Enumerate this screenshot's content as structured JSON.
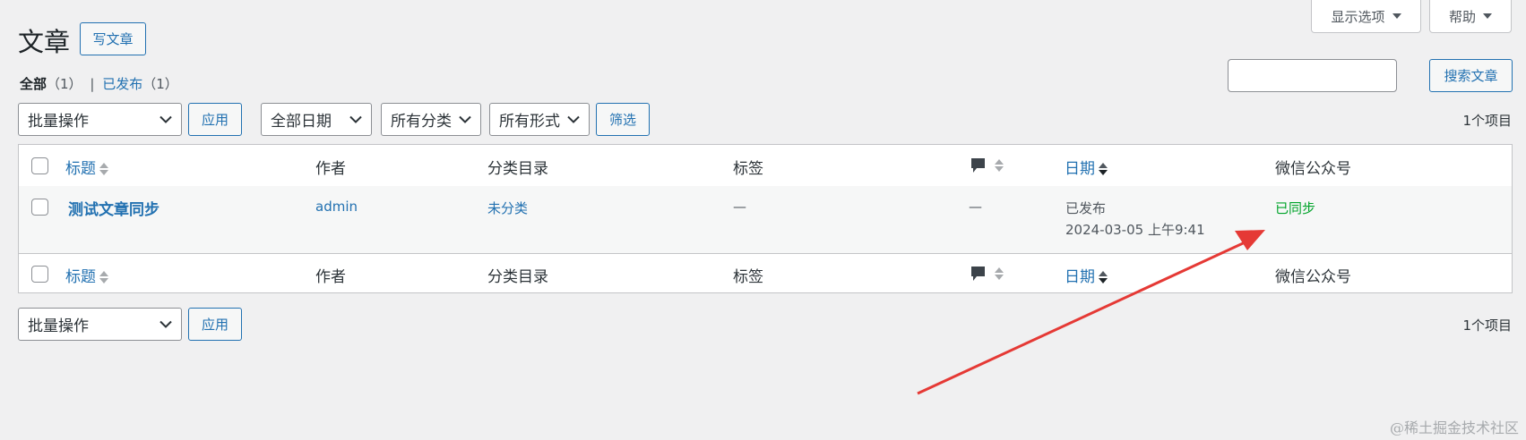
{
  "top_buttons": {
    "screen_options": "显示选项",
    "help": "帮助"
  },
  "page": {
    "title": "文章",
    "add_new": "写文章"
  },
  "filters": {
    "all_label": "全部",
    "all_count": "（1）",
    "separator": "|",
    "published_label": "已发布",
    "published_count": "（1）"
  },
  "search": {
    "value": "",
    "button": "搜索文章"
  },
  "tablenav": {
    "bulk_action": "批量操作",
    "apply": "应用",
    "dates": "全部日期",
    "categories": "所有分类",
    "formats": "所有形式",
    "filter": "筛选",
    "count": "1个项目"
  },
  "columns": {
    "title": "标题",
    "author": "作者",
    "categories": "分类目录",
    "tags": "标签",
    "date": "日期",
    "wechat": "微信公众号"
  },
  "rows": [
    {
      "title": "测试文章同步",
      "author": "admin",
      "category": "未分类",
      "tags": "—",
      "comments": "—",
      "status": "已发布",
      "datetime": "2024-03-05 上午9:41",
      "wechat_status": "已同步"
    }
  ],
  "watermark": "@稀土掘金技术社区",
  "colors": {
    "link": "#2271b1",
    "synced": "#00a32a",
    "arrow": "#e53935"
  },
  "icons": {
    "comments": "comment-bubble-icon",
    "sort": "sort-arrows-icon",
    "dropdown": "chevron-down-icon"
  }
}
